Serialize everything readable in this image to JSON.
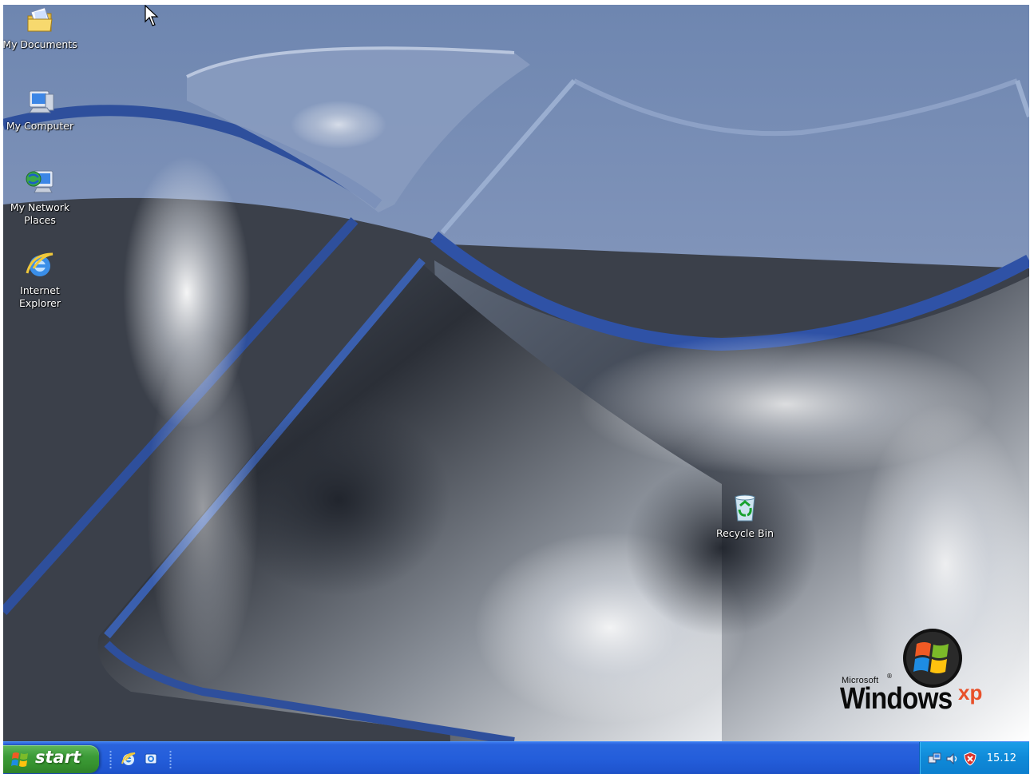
{
  "desktop": {
    "icons": [
      {
        "label": "My Documents",
        "icon": "my-documents-folder-icon"
      },
      {
        "label": "My Computer",
        "icon": "my-computer-icon"
      },
      {
        "label": "My Network\nPlaces",
        "icon": "network-places-icon"
      },
      {
        "label": "Internet\nExplorer",
        "icon": "internet-explorer-icon"
      },
      {
        "label": "Recycle Bin",
        "icon": "recycle-bin-icon"
      }
    ],
    "logo": {
      "microsoft": "Microsoft",
      "registered": "®",
      "windows": "Windows",
      "xp": "xp"
    }
  },
  "taskbar": {
    "start_label": "start",
    "quick_launch": [
      "internet-explorer-icon",
      "outlook-express-icon"
    ],
    "tray_icons": [
      "network-icon",
      "volume-icon",
      "security-center-icon"
    ],
    "clock": "15.12"
  },
  "colors": {
    "taskbar_blue": "#245edb",
    "start_green": "#3c9b38",
    "tray_blue": "#0f8ad8"
  }
}
